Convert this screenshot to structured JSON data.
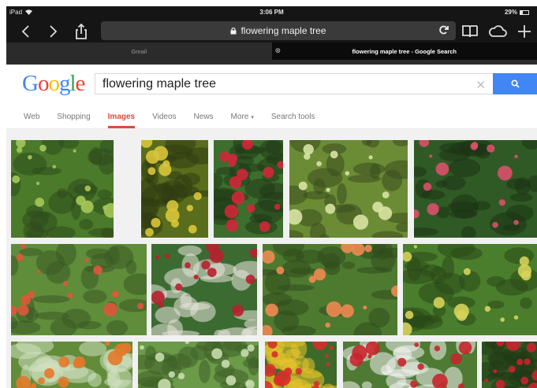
{
  "status": {
    "device": "iPad",
    "time": "3:06 PM",
    "battery": "29%",
    "battery_fraction": 0.29
  },
  "browser": {
    "url": "flowering maple tree",
    "tabs": [
      {
        "label": "Gmail",
        "active": false
      },
      {
        "label": "flowering maple tree - Google Search",
        "active": true
      }
    ]
  },
  "google": {
    "logo": "Google",
    "query": "flowering maple tree",
    "nav": [
      {
        "label": "Web",
        "active": false
      },
      {
        "label": "Shopping",
        "active": false
      },
      {
        "label": "Images",
        "active": true
      },
      {
        "label": "Videos",
        "active": false
      },
      {
        "label": "News",
        "active": false
      },
      {
        "label": "More",
        "active": false,
        "dropdown": true
      },
      {
        "label": "Search tools",
        "active": false
      }
    ],
    "colors": {
      "blue": "#4285f4",
      "red": "#ea4335",
      "yellow": "#fbbc05",
      "green": "#34a853",
      "active_tab": "#dd4b39"
    }
  },
  "results": {
    "rows": [
      [
        {
          "subject": "green shrub",
          "palette": [
            "#4b7a2a",
            "#a6c85a",
            "#2d4a1c"
          ]
        },
        {
          "subject": "yellow flowers",
          "palette": [
            "#5a6d1c",
            "#d8c43a",
            "#2f3d12"
          ]
        },
        {
          "subject": "red hanging flowers",
          "palette": [
            "#3e6e2e",
            "#d0273a",
            "#1f3a17"
          ]
        },
        {
          "subject": "maple leaves",
          "palette": [
            "#6b8c35",
            "#d9e3a3",
            "#3a4b1e"
          ]
        },
        {
          "subject": "pink bell flowers",
          "palette": [
            "#2f5a25",
            "#d9506a",
            "#1c3314"
          ]
        }
      ],
      [
        {
          "subject": "orange flowers leaves",
          "palette": [
            "#5f8d3a",
            "#e0563a",
            "#3b5a24"
          ]
        },
        {
          "subject": "potted red flowers",
          "palette": [
            "#3c6b32",
            "#b8202e",
            "#eae6dc"
          ]
        },
        {
          "subject": "orange flower closeup",
          "palette": [
            "#4e7a30",
            "#ef8a52",
            "#2f4a1d"
          ]
        },
        {
          "subject": "variegated leaves",
          "palette": [
            "#4a7d2c",
            "#d6d25a",
            "#2a4817"
          ]
        }
      ],
      [
        {
          "subject": "orange bloom",
          "palette": [
            "#628c3a",
            "#e3792a",
            "#cfe0c0"
          ]
        },
        {
          "subject": "leaf canopy",
          "palette": [
            "#6b9a48",
            "#c8dcae",
            "#3e6128"
          ]
        },
        {
          "subject": "red yellow flowers",
          "palette": [
            "#3d6a2a",
            "#d6302a",
            "#e6c22a"
          ]
        },
        {
          "subject": "red tropical flower",
          "palette": [
            "#4e7a34",
            "#c7262e",
            "#f2f2f2"
          ]
        },
        {
          "subject": "red blossoms",
          "palette": [
            "#3a6328",
            "#c8242c",
            "#203b15"
          ]
        }
      ]
    ]
  }
}
